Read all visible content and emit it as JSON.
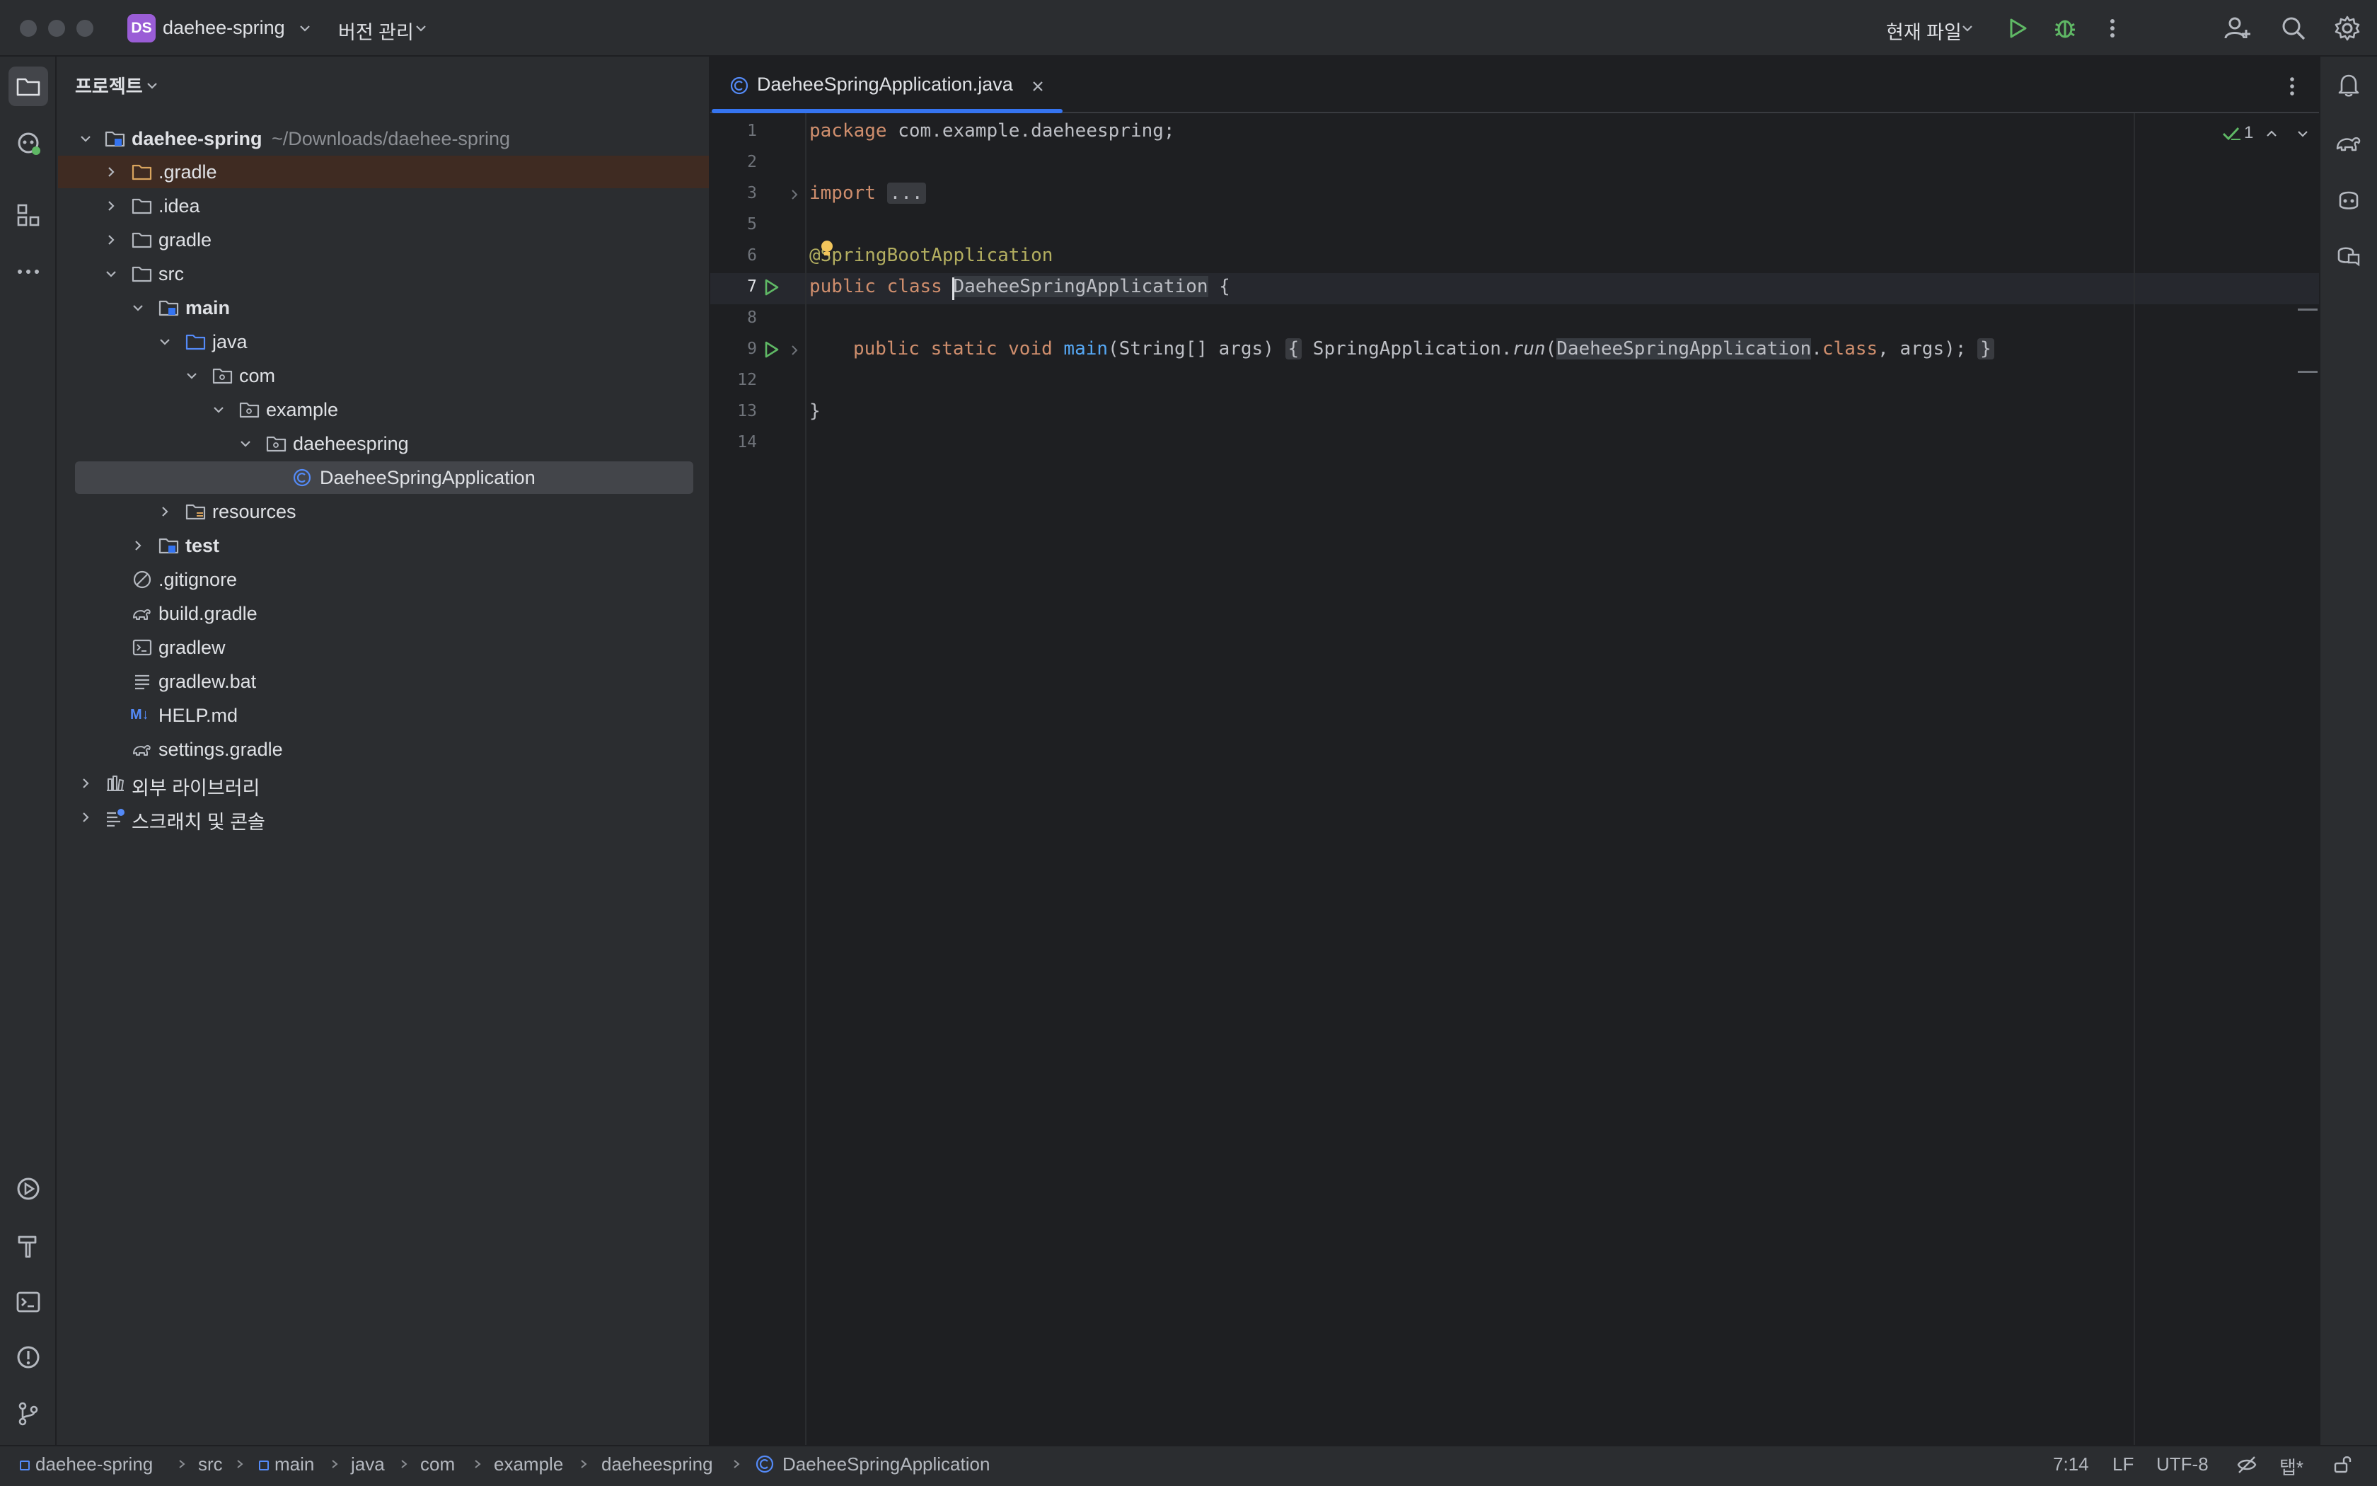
{
  "titlebar": {
    "project_badge": "DS",
    "project_name": "daehee-spring",
    "vcs_menu": "버전 관리",
    "run_config": "현재 파일"
  },
  "project_panel": {
    "title": "프로젝트",
    "tree": {
      "root": {
        "label": "daehee-spring",
        "path": "~/Downloads/daehee-spring"
      },
      "gradle_dir": ".gradle",
      "idea_dir": ".idea",
      "gradle": "gradle",
      "src": "src",
      "main": "main",
      "java": "java",
      "com": "com",
      "example": "example",
      "daeheespring": "daeheespring",
      "app_class": "DaeheeSpringApplication",
      "resources": "resources",
      "test": "test",
      "gitignore": ".gitignore",
      "build_gradle": "build.gradle",
      "gradlew": "gradlew",
      "gradlew_bat": "gradlew.bat",
      "help_md": "HELP.md",
      "md_badge": "M↓",
      "settings_gradle": "settings.gradle",
      "external_libs": "외부 라이브러리",
      "scratches": "스크래치 및 콘솔"
    }
  },
  "editor": {
    "tab_label": "DaeheeSpringApplication.java",
    "inspection_count": "1",
    "line_numbers": [
      "1",
      "2",
      "3",
      "5",
      "6",
      "7",
      "8",
      "9",
      "12",
      "13",
      "14"
    ],
    "code": {
      "l1_kw": "package",
      "l1_rest": " com.example.daeheespring;",
      "l3_kw": "import",
      "l3_fold": "...",
      "l6": "@SpringBootApplication",
      "l7_kw": "public class ",
      "l7_name": "DaeheeSpringApplication",
      "l7_brace": " {",
      "l9_kw": "public static void ",
      "l9_fn": "main",
      "l9_params": "(String[] args) ",
      "l9_lb": "{",
      "l9_sa": " SpringApplication.",
      "l9_run": "run",
      "l9_p": "(",
      "l9_cls": "DaeheeSpringApplication",
      "l9_dot": ".",
      "l9_class_kw": "class",
      "l9_end": ", args); ",
      "l9_rb": "}",
      "l13": "}"
    }
  },
  "statusbar": {
    "breadcrumbs": [
      "daehee-spring",
      "src",
      "main",
      "java",
      "com",
      "example",
      "daeheespring",
      "DaeheeSpringApplication"
    ],
    "position": "7:14",
    "line_sep": "LF",
    "encoding": "UTF-8",
    "indent": "탭*"
  }
}
